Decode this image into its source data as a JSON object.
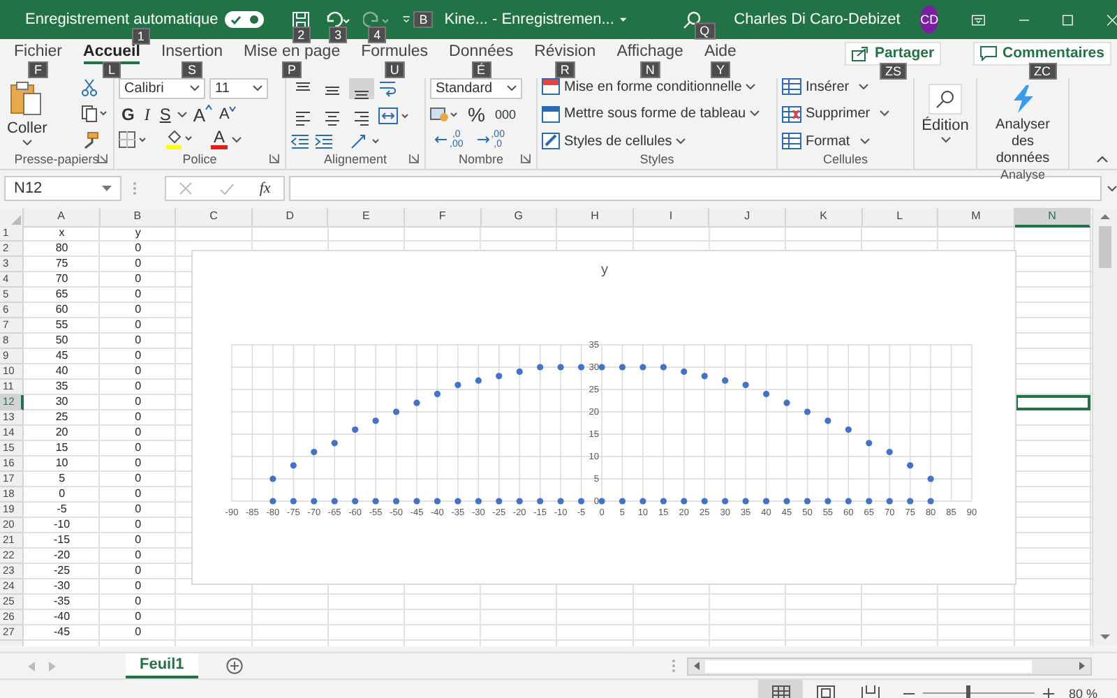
{
  "title_bar": {
    "autosave": {
      "label": "Enregistrement automatique",
      "on": true,
      "keytip": "1"
    },
    "save": {
      "keytip": "2"
    },
    "undo": {
      "keytip": "3"
    },
    "redo": {
      "disabled": true,
      "keytip": "4"
    },
    "file": {
      "title": "Kine...  -  Enregistremen...",
      "keytip": "B"
    },
    "search": {
      "keytip": "Q"
    },
    "user": {
      "name": "Charles Di Caro-Debizet",
      "initials": "CD"
    }
  },
  "tabs": [
    {
      "label": "Fichier",
      "selected": false,
      "keytip": "F"
    },
    {
      "label": "Accueil",
      "selected": true,
      "keytip": "L"
    },
    {
      "label": "Insertion",
      "selected": false,
      "keytip": "S"
    },
    {
      "label": "Mise en page",
      "selected": false,
      "keytip": "P"
    },
    {
      "label": "Formules",
      "selected": false,
      "keytip": "U"
    },
    {
      "label": "Données",
      "selected": false,
      "keytip": "É"
    },
    {
      "label": "Révision",
      "selected": false,
      "keytip": "R"
    },
    {
      "label": "Affichage",
      "selected": false,
      "keytip": "N"
    },
    {
      "label": "Aide",
      "selected": false,
      "keytip": "Y"
    }
  ],
  "share": {
    "label": "Partager",
    "keytip": "ZS"
  },
  "comments": {
    "label": "Commentaires",
    "keytip": "ZC"
  },
  "ribbon": {
    "clipboard": {
      "paste": "Coller",
      "group": "Presse-papiers"
    },
    "font": {
      "name": "Calibri",
      "size": "11",
      "styles": [
        "G",
        "I",
        "S"
      ],
      "grow": "A",
      "shrink": "A",
      "color_letter": "A",
      "group": "Police"
    },
    "alignment": {
      "vertical": [
        {
          "kind": "top",
          "selected": false
        },
        {
          "kind": "middle",
          "selected": false
        },
        {
          "kind": "bottom",
          "selected": true
        }
      ],
      "horizontal": [
        {
          "kind": "left",
          "selected": false
        },
        {
          "kind": "center",
          "selected": false
        },
        {
          "kind": "right",
          "selected": false
        }
      ],
      "group": "Alignement"
    },
    "number": {
      "format": "Standard",
      "percent": "%",
      "thousands": "000",
      "decimals": [
        {
          "kind": "increase",
          "top": ",0",
          "bottom": ",00"
        },
        {
          "kind": "decrease",
          "top": ",00",
          "bottom": ",0"
        }
      ],
      "group": "Nombre"
    },
    "styles": {
      "items": [
        "Mise en forme conditionnelle",
        "Mettre sous forme de tableau",
        "Styles de cellules"
      ],
      "group": "Styles"
    },
    "cells": {
      "items": [
        "Insérer",
        "Supprimer",
        "Format"
      ],
      "group": "Cellules"
    },
    "editing": {
      "label": "Édition"
    },
    "analysis": {
      "label": "Analyser des données",
      "group": "Analyse"
    }
  },
  "formula_bar": {
    "name_box": "N12",
    "fx": "fx"
  },
  "sheet": {
    "columns": [
      {
        "label": "A",
        "selected": false
      },
      {
        "label": "B",
        "selected": false
      },
      {
        "label": "C",
        "selected": false
      },
      {
        "label": "D",
        "selected": false
      },
      {
        "label": "E",
        "selected": false
      },
      {
        "label": "F",
        "selected": false
      },
      {
        "label": "G",
        "selected": false
      },
      {
        "label": "H",
        "selected": false
      },
      {
        "label": "I",
        "selected": false
      },
      {
        "label": "J",
        "selected": false
      },
      {
        "label": "K",
        "selected": false
      },
      {
        "label": "L",
        "selected": false
      },
      {
        "label": "M",
        "selected": false
      },
      {
        "label": "N",
        "selected": true
      }
    ],
    "rows": [
      {
        "n": "1",
        "a": "x",
        "b": "y",
        "selected": false
      },
      {
        "n": "2",
        "a": "80",
        "b": "0",
        "selected": false
      },
      {
        "n": "3",
        "a": "75",
        "b": "0",
        "selected": false
      },
      {
        "n": "4",
        "a": "70",
        "b": "0",
        "selected": false
      },
      {
        "n": "5",
        "a": "65",
        "b": "0",
        "selected": false
      },
      {
        "n": "6",
        "a": "60",
        "b": "0",
        "selected": false
      },
      {
        "n": "7",
        "a": "55",
        "b": "0",
        "selected": false
      },
      {
        "n": "8",
        "a": "50",
        "b": "0",
        "selected": false
      },
      {
        "n": "9",
        "a": "45",
        "b": "0",
        "selected": false
      },
      {
        "n": "10",
        "a": "40",
        "b": "0",
        "selected": false
      },
      {
        "n": "11",
        "a": "35",
        "b": "0",
        "selected": false
      },
      {
        "n": "12",
        "a": "30",
        "b": "0",
        "selected": true
      },
      {
        "n": "13",
        "a": "25",
        "b": "0",
        "selected": false
      },
      {
        "n": "14",
        "a": "20",
        "b": "0",
        "selected": false
      },
      {
        "n": "15",
        "a": "15",
        "b": "0",
        "selected": false
      },
      {
        "n": "16",
        "a": "10",
        "b": "0",
        "selected": false
      },
      {
        "n": "17",
        "a": "5",
        "b": "0",
        "selected": false
      },
      {
        "n": "18",
        "a": "0",
        "b": "0",
        "selected": false
      },
      {
        "n": "19",
        "a": "-5",
        "b": "0",
        "selected": false
      },
      {
        "n": "20",
        "a": "-10",
        "b": "0",
        "selected": false
      },
      {
        "n": "21",
        "a": "-15",
        "b": "0",
        "selected": false
      },
      {
        "n": "22",
        "a": "-20",
        "b": "0",
        "selected": false
      },
      {
        "n": "23",
        "a": "-25",
        "b": "0",
        "selected": false
      },
      {
        "n": "24",
        "a": "-30",
        "b": "0",
        "selected": false
      },
      {
        "n": "25",
        "a": "-35",
        "b": "0",
        "selected": false
      },
      {
        "n": "26",
        "a": "-40",
        "b": "0",
        "selected": false
      },
      {
        "n": "27",
        "a": "-45",
        "b": "0",
        "selected": false
      }
    ],
    "chart": {
      "chart_data": {
        "type": "scatter",
        "title": "y",
        "x": [
          -80,
          -75,
          -70,
          -65,
          -60,
          -55,
          -50,
          -45,
          -40,
          -35,
          -30,
          -25,
          -20,
          -15,
          -10,
          -5,
          0,
          5,
          10,
          15,
          20,
          25,
          30,
          35,
          40,
          45,
          50,
          55,
          60,
          65,
          70,
          75,
          80,
          -80,
          -75,
          -70,
          -65,
          -60,
          -55,
          -50,
          -45,
          -40,
          -35,
          -30,
          -25,
          -20,
          -15,
          -10,
          -5,
          0,
          5,
          10,
          15,
          20,
          25,
          30,
          35,
          40,
          45,
          50,
          55,
          60,
          65,
          70,
          75,
          80
        ],
        "grid": true,
        "series": [
          {
            "color": "#4472c4",
            "values": [
              5,
              8,
              11,
              13,
              16,
              18,
              20,
              22,
              24,
              26,
              27,
              28,
              29,
              30,
              30,
              30,
              30,
              30,
              30,
              30,
              29,
              28,
              27,
              26,
              24,
              22,
              20,
              18,
              16,
              13,
              11,
              8,
              5,
              0,
              0,
              0,
              0,
              0,
              0,
              0,
              0,
              0,
              0,
              0,
              0,
              0,
              0,
              0,
              0,
              0,
              0,
              0,
              0,
              0,
              0,
              0,
              0,
              0,
              0,
              0,
              0,
              0,
              0,
              0,
              0,
              0
            ]
          }
        ],
        "xlim": [
          -90,
          90
        ],
        "ylim": [
          0,
          35
        ],
        "xticks": [
          -90,
          -85,
          -80,
          -75,
          -70,
          -65,
          -60,
          -55,
          -50,
          -45,
          -40,
          -35,
          -30,
          -25,
          -20,
          -15,
          -10,
          -5,
          0,
          5,
          10,
          15,
          20,
          25,
          30,
          35,
          40,
          45,
          50,
          55,
          60,
          65,
          70,
          75,
          80,
          85,
          90
        ],
        "yticks": [
          0,
          5,
          10,
          15,
          20,
          25,
          30,
          35
        ]
      }
    }
  },
  "sheet_tabs": [
    {
      "label": "Feuil1",
      "selected": true
    }
  ],
  "status_bar": {
    "views": [
      {
        "kind": "normal",
        "selected": true
      },
      {
        "kind": "layout",
        "selected": false
      },
      {
        "kind": "pagebreak",
        "selected": false
      }
    ],
    "zoom": {
      "level": 0.4,
      "label": "80 %"
    }
  }
}
